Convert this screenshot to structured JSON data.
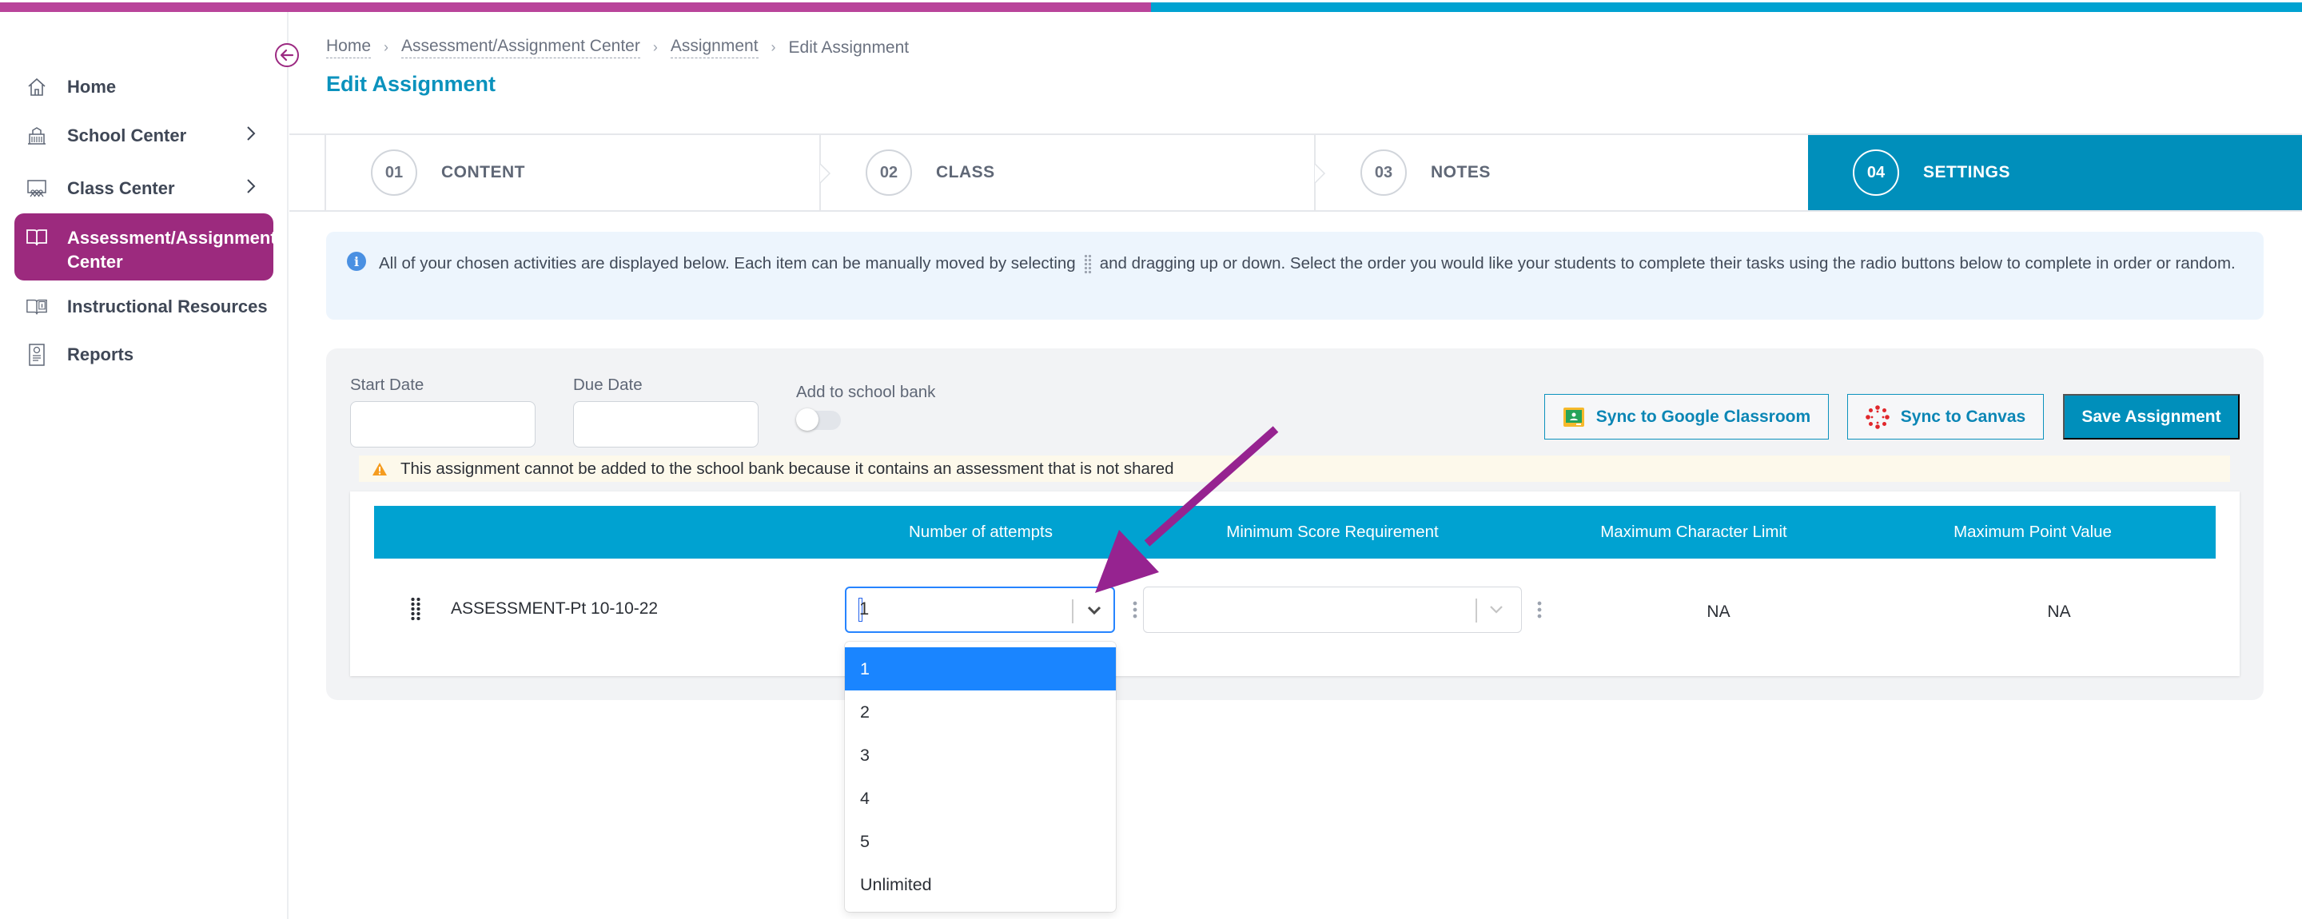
{
  "colors": {
    "brand_magenta": "#b9449a",
    "brand_blue": "#00a2d1",
    "accent_teal": "#008fbb",
    "active_nav": "#9c2a7e",
    "select_focus": "#2684ff",
    "option_selected": "#1a85ff",
    "annotation_arrow": "#962390"
  },
  "sidebar": {
    "collapse_icon": "arrow-left-circle-icon",
    "items": [
      {
        "label": "Home",
        "icon": "home-icon",
        "has_chevron": false,
        "active": false
      },
      {
        "label": "School Center",
        "icon": "school-building-icon",
        "has_chevron": true,
        "active": false
      },
      {
        "label": "Class Center",
        "icon": "classroom-icon",
        "has_chevron": true,
        "active": false
      },
      {
        "label": "Assessment/Assignment Center",
        "icon": "open-book-icon",
        "has_chevron": false,
        "active": true
      },
      {
        "label": "Instructional Resources",
        "icon": "book-info-icon",
        "has_chevron": false,
        "active": false
      },
      {
        "label": "Reports",
        "icon": "report-document-icon",
        "has_chevron": false,
        "active": false
      }
    ]
  },
  "breadcrumb": [
    {
      "label": "Home",
      "link": true
    },
    {
      "label": "Assessment/Assignment Center",
      "link": true
    },
    {
      "label": "Assignment",
      "link": true
    },
    {
      "label": "Edit Assignment",
      "link": false
    }
  ],
  "page_title": "Edit Assignment",
  "steps": [
    {
      "number": "01",
      "label": "CONTENT",
      "active": false
    },
    {
      "number": "02",
      "label": "CLASS",
      "active": false
    },
    {
      "number": "03",
      "label": "NOTES",
      "active": false
    },
    {
      "number": "04",
      "label": "SETTINGS",
      "active": true
    }
  ],
  "info_banner": {
    "icon": "info-icon",
    "text_before": "All of your chosen activities are displayed below. Each item can be manually moved by selecting",
    "text_after": "and dragging up or down. Select the order you would like your students to complete their tasks using the radio buttons below to complete in order or random."
  },
  "settings": {
    "start_date": {
      "label": "Start Date",
      "value": ""
    },
    "due_date": {
      "label": "Due Date",
      "value": ""
    },
    "school_bank": {
      "label": "Add to school bank",
      "enabled": false
    },
    "buttons": {
      "google": "Sync to Google Classroom",
      "canvas": "Sync to Canvas",
      "save": "Save Assignment"
    },
    "warning": "This assignment cannot be added to the school bank because it contains an assessment that is not shared"
  },
  "table": {
    "columns": [
      "",
      "Number of attempts",
      "Minimum Score Requirement",
      "Maximum Character Limit",
      "Maximum Point Value"
    ],
    "rows": [
      {
        "name": "ASSESSMENT-Pt 10-10-22",
        "attempts": "1",
        "min_score": "",
        "max_char_limit": "NA",
        "max_point_value": "NA"
      }
    ]
  },
  "attempts_dropdown": {
    "open": true,
    "selected": "1",
    "options": [
      "1",
      "2",
      "3",
      "4",
      "5",
      "Unlimited"
    ]
  }
}
